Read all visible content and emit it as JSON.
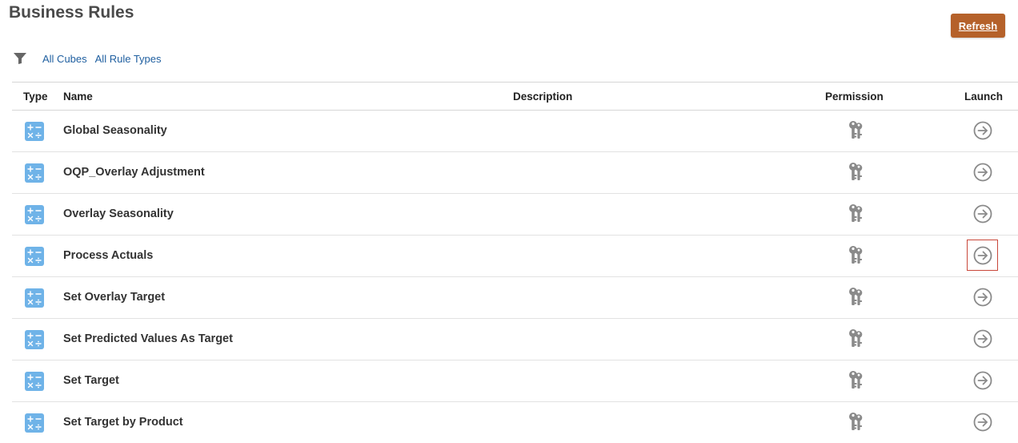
{
  "header": {
    "title": "Business Rules",
    "refresh_label": "Refresh"
  },
  "filters": {
    "cube": "All Cubes",
    "rule_type": "All Rule Types"
  },
  "table": {
    "columns": {
      "type": "Type",
      "name": "Name",
      "description": "Description",
      "permission": "Permission",
      "launch": "Launch"
    },
    "rows": [
      {
        "name": "Global Seasonality",
        "description": ""
      },
      {
        "name": "OQP_Overlay Adjustment",
        "description": ""
      },
      {
        "name": "Overlay Seasonality",
        "description": ""
      },
      {
        "name": "Process Actuals",
        "description": ""
      },
      {
        "name": "Set Overlay Target",
        "description": ""
      },
      {
        "name": "Set Predicted Values As Target",
        "description": ""
      },
      {
        "name": "Set Target",
        "description": ""
      },
      {
        "name": "Set Target by Product",
        "description": ""
      }
    ],
    "focused_launch_row": 3
  },
  "icons": {
    "filter": "filter-icon",
    "type": "calculation-rule-icon",
    "permission": "keys-icon",
    "launch": "arrow-right-circle-icon"
  },
  "colors": {
    "accent": "#b5612a",
    "link": "#1f5fa0",
    "type_icon": "#6fb3e8",
    "focus_outline": "#c9473a"
  }
}
